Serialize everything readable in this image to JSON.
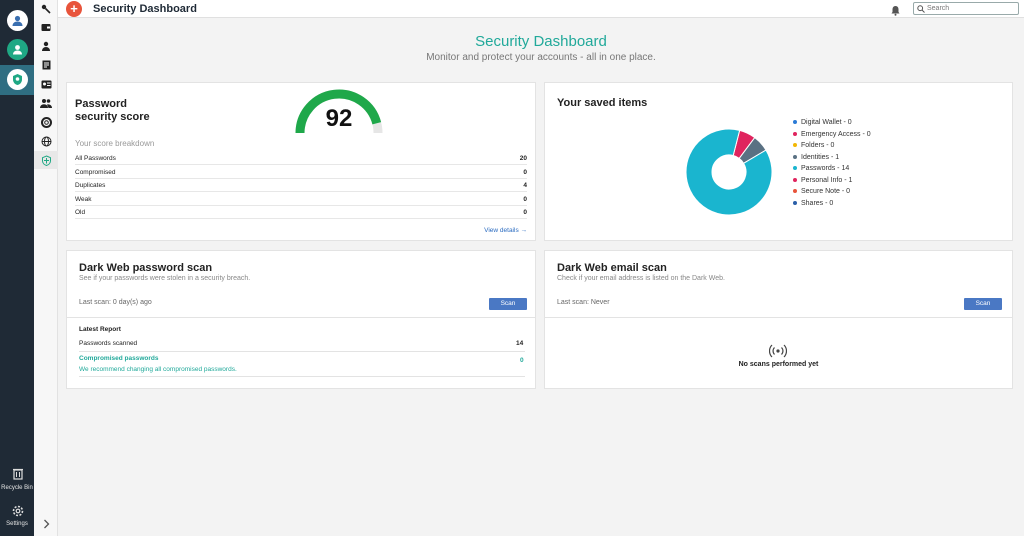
{
  "rail": {
    "recycle_label": "Recycle Bin",
    "settings_label": "Settings"
  },
  "topbar": {
    "add_label": "+",
    "title": "Security Dashboard",
    "search_placeholder": "Search"
  },
  "hero": {
    "title": "Security Dashboard",
    "subtitle": "Monitor and protect your accounts - all in one place."
  },
  "score_card": {
    "title_line1": "Password",
    "title_line2": "security score",
    "score": "92",
    "score_fraction": 0.92,
    "gauge_color": "#1fa84a",
    "breakdown_label": "Your score breakdown",
    "rows": [
      {
        "label": "All Passwords",
        "value": "20"
      },
      {
        "label": "Compromised",
        "value": "0"
      },
      {
        "label": "Duplicates",
        "value": "4"
      },
      {
        "label": "Weak",
        "value": "0"
      },
      {
        "label": "Old",
        "value": "0"
      }
    ],
    "view_details": "View details →"
  },
  "saved_items": {
    "title": "Your saved items",
    "legend": [
      {
        "label": "Digital Wallet - 0",
        "color": "#2b7bd6",
        "value": 0
      },
      {
        "label": "Emergency Access - 0",
        "color": "#e0245e",
        "value": 0
      },
      {
        "label": "Folders - 0",
        "color": "#f2b705",
        "value": 0
      },
      {
        "label": "Identities - 1",
        "color": "#5a7183",
        "value": 1
      },
      {
        "label": "Passwords - 14",
        "color": "#1ab5cf",
        "value": 14
      },
      {
        "label": "Personal Info - 1",
        "color": "#e0245e",
        "value": 1
      },
      {
        "label": "Secure Note - 0",
        "color": "#e8543b",
        "value": 0
      },
      {
        "label": "Shares - 0",
        "color": "#2b5fa8",
        "value": 0
      }
    ]
  },
  "dark_web_pw": {
    "title": "Dark Web password scan",
    "subtitle": "See if your passwords were stolen in a security breach.",
    "last_scan": "Last scan: 0 day(s) ago",
    "scan_label": "Scan",
    "report_title": "Latest Report",
    "scanned_label": "Passwords scanned",
    "scanned_value": "14",
    "compromised_label": "Compromised passwords",
    "compromised_value": "0",
    "recommend": "We recommend changing all compromised passwords."
  },
  "dark_web_email": {
    "title": "Dark Web email scan",
    "subtitle": "Check if your email address is listed on the Dark Web.",
    "last_scan": "Last scan: Never",
    "scan_label": "Scan",
    "empty_text": "No scans performed yet"
  },
  "colors": {
    "accent": "#21a99a",
    "brand_dark": "#1f2a36",
    "button_blue": "#4a78c4",
    "add_red": "#e8543b"
  }
}
